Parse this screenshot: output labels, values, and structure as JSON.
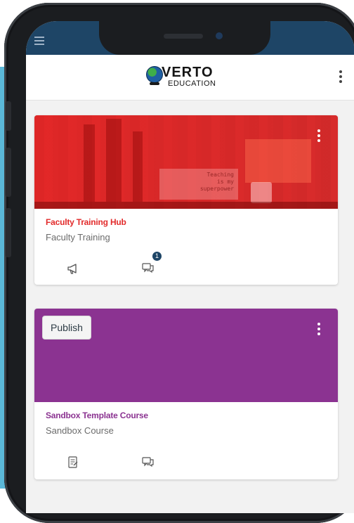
{
  "app": {
    "logo_word": "VERTO",
    "logo_sub": "EDUCATION"
  },
  "colors": {
    "status_bar": "#1e4566",
    "faculty_accent": "#e22b2b",
    "sandbox_accent": "#8b3391",
    "backdrop": "#5bb8d8"
  },
  "courses": [
    {
      "title": "Faculty Training Hub",
      "subtitle": "Faculty Training",
      "banner_text": [
        "Teaching",
        "is my",
        "superpower"
      ],
      "actions": [
        {
          "icon": "megaphone-icon"
        },
        {
          "icon": "discussions-icon",
          "badge": "1"
        }
      ]
    },
    {
      "title": "Sandbox Template Course",
      "subtitle": "Sandbox Course",
      "publish_label": "Publish",
      "actions": [
        {
          "icon": "assignments-icon"
        },
        {
          "icon": "discussions-icon"
        }
      ]
    }
  ]
}
